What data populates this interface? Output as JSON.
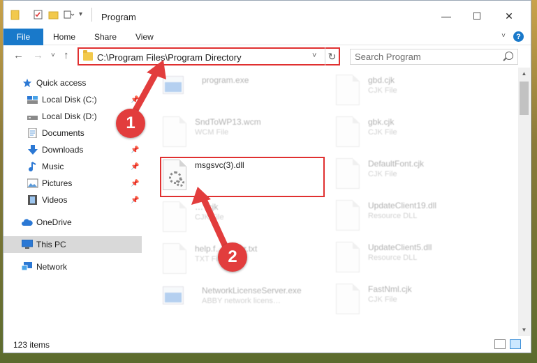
{
  "window": {
    "title": "Program",
    "controls": {
      "minimize": "—",
      "maximize": "☐",
      "close": "✕"
    }
  },
  "ribbon": {
    "tabs": [
      "File",
      "Home",
      "Share",
      "View"
    ],
    "help": "?",
    "expand": "˅"
  },
  "address": {
    "path": "C:\\Program Files\\Program Directory",
    "dropdown": "˅",
    "refresh": "↻",
    "back": "←",
    "forward": "→",
    "recent": "˅",
    "up": "↑"
  },
  "search": {
    "placeholder": "Search Program"
  },
  "nav_pane": {
    "items": [
      {
        "label": "Quick access",
        "icon": "star-icon"
      },
      {
        "label": "Local Disk (C:)",
        "icon": "drive-icon",
        "pinned": true
      },
      {
        "label": "Local Disk (D:)",
        "icon": "drive-icon"
      },
      {
        "label": "Documents",
        "icon": "documents-icon",
        "pinned": true
      },
      {
        "label": "Downloads",
        "icon": "download-icon",
        "pinned": true
      },
      {
        "label": "Music",
        "icon": "music-icon",
        "pinned": true
      },
      {
        "label": "Pictures",
        "icon": "pictures-icon",
        "pinned": true
      },
      {
        "label": "Videos",
        "icon": "videos-icon",
        "pinned": true
      },
      {
        "label": "OneDrive",
        "icon": "cloud-icon"
      },
      {
        "label": "This PC",
        "icon": "pc-icon",
        "selected": true
      },
      {
        "label": "Network",
        "icon": "network-icon"
      }
    ]
  },
  "files": {
    "left": [
      {
        "name": "program.exe",
        "type": ""
      },
      {
        "name": "SndToWP13.wcm",
        "type": "WCM File"
      },
      {
        "name": "msgsvc(3).dll",
        "type": ""
      },
      {
        "name": "… .cjk",
        "type": "CJK File"
      },
      {
        "name": "help.f… …der.txt",
        "type": "TXT File"
      },
      {
        "name": "NetworkLicenseServer.exe",
        "type": "ABBY network licens…"
      }
    ],
    "right": [
      {
        "name": "gbd.cjk",
        "type": "CJK File"
      },
      {
        "name": "gbk.cjk",
        "type": "CJK File"
      },
      {
        "name": "DefaultFont.cjk",
        "type": "CJK File"
      },
      {
        "name": "UpdateClient19.dll",
        "type": "Resource DLL"
      },
      {
        "name": "UpdateClient5.dll",
        "type": "Resource DLL"
      },
      {
        "name": "FastNml.cjk",
        "type": "CJK File"
      }
    ]
  },
  "status": {
    "items_count": "123 items"
  },
  "callouts": {
    "one": "1",
    "two": "2"
  },
  "colors": {
    "accent": "#1979ca",
    "highlight": "#e03030",
    "callout": "#e23d3d"
  }
}
